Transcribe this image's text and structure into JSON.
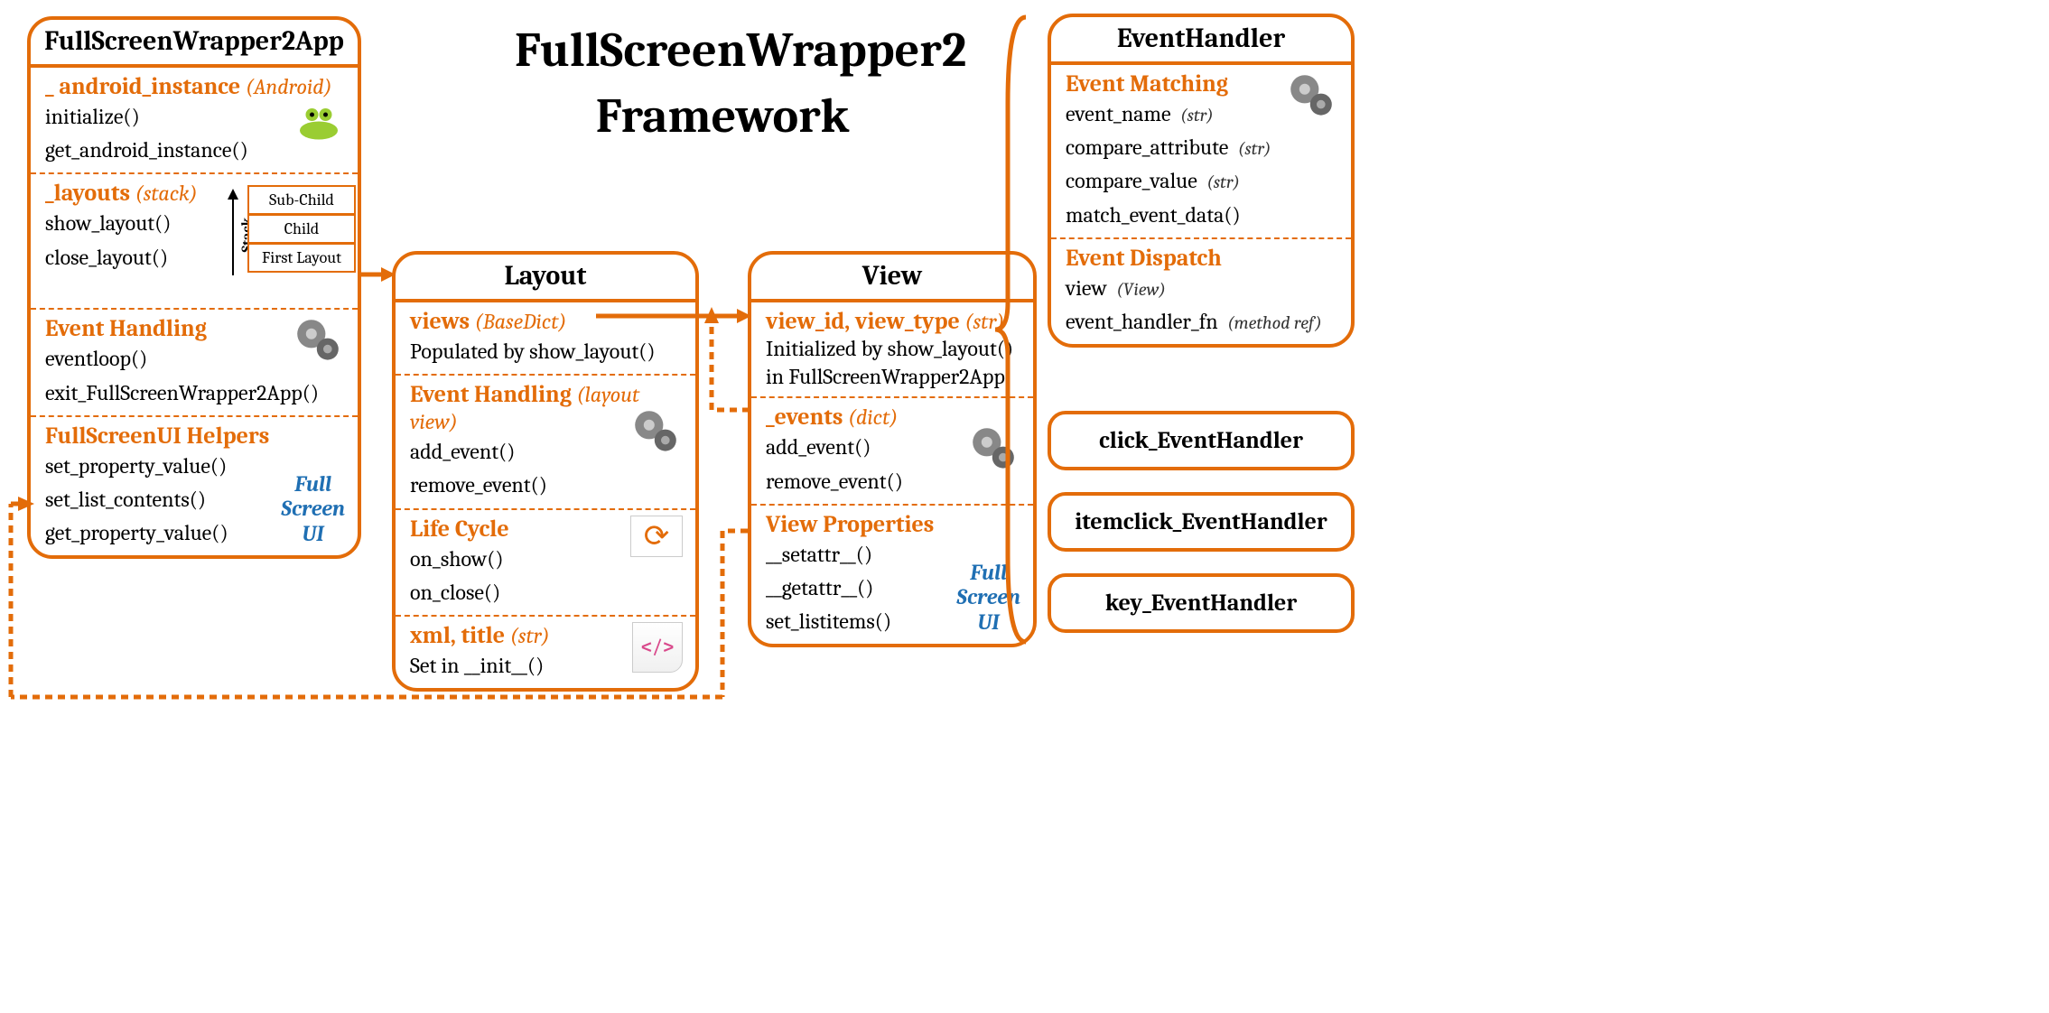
{
  "title_line1": "FullScreenWrapper2",
  "title_line2": "Framework",
  "app": {
    "header": "FullScreenWrapper2App",
    "s1_title": "_ android_instance",
    "s1_paren": "(Android)",
    "s1_i1": "initialize()",
    "s1_i2": "get_android_instance()",
    "s2_title": "_layouts",
    "s2_paren": "(stack)",
    "s2_i1": "show_layout()",
    "s2_i2": "close_layout()",
    "stack_label": "Stack",
    "stack_top": "Sub-Child",
    "stack_mid": "Child",
    "stack_bot": "First Layout",
    "s3_title": "Event Handling",
    "s3_i1": "eventloop()",
    "s3_i2": "exit_FullScreenWrapper2App()",
    "s4_title": "FullScreenUI Helpers",
    "s4_i1": "set_property_value()",
    "s4_i2": "set_list_contents()",
    "s4_i3": "get_property_value()",
    "fsui_l1": "Full",
    "fsui_l2": "Screen",
    "fsui_l3": "UI"
  },
  "layout": {
    "header": "Layout",
    "s1_title": "views",
    "s1_paren": "(BaseDict)",
    "s1_i1": "Populated by show_layout()",
    "s2_title": "Event Handling",
    "s2_paren": "(layout view)",
    "s2_i1": "add_event()",
    "s2_i2": "remove_event()",
    "s3_title": "Life Cycle",
    "s3_i1": "on_show()",
    "s3_i2": "on_close()",
    "s4_title": "xml, title",
    "s4_paren": "(str)",
    "s4_i1": "Set in __init__()"
  },
  "view": {
    "header": "View",
    "s1_title": "view_id, view_type",
    "s1_paren": "(str)",
    "s1_i1": "Initialized by show_layout() in FullScreenWrapper2App",
    "s2_title": "_events",
    "s2_paren": "(dict)",
    "s2_i1": "add_event()",
    "s2_i2": "remove_event()",
    "s3_title": "View Properties",
    "s3_i1": "__setattr__()",
    "s3_i2": "__getattr__()",
    "s3_i3": "set_listitems()",
    "fsui_l1": "Full",
    "fsui_l2": "Screen",
    "fsui_l3": "UI"
  },
  "eh": {
    "header": "EventHandler",
    "s1_title": "Event Matching",
    "s1_i1": "event_name",
    "s1_i1p": "(str)",
    "s1_i2": "compare_attribute",
    "s1_i2p": "(str)",
    "s1_i3": "compare_value",
    "s1_i3p": "(str)",
    "s1_i4": "match_event_data()",
    "s2_title": "Event Dispatch",
    "s2_i1": "view",
    "s2_i1p": "(View)",
    "s2_i2": "event_handler_fn",
    "s2_i2p": "(method ref)"
  },
  "sub1": "click_EventHandler",
  "sub2": "itemclick_EventHandler",
  "sub3": "key_EventHandler"
}
